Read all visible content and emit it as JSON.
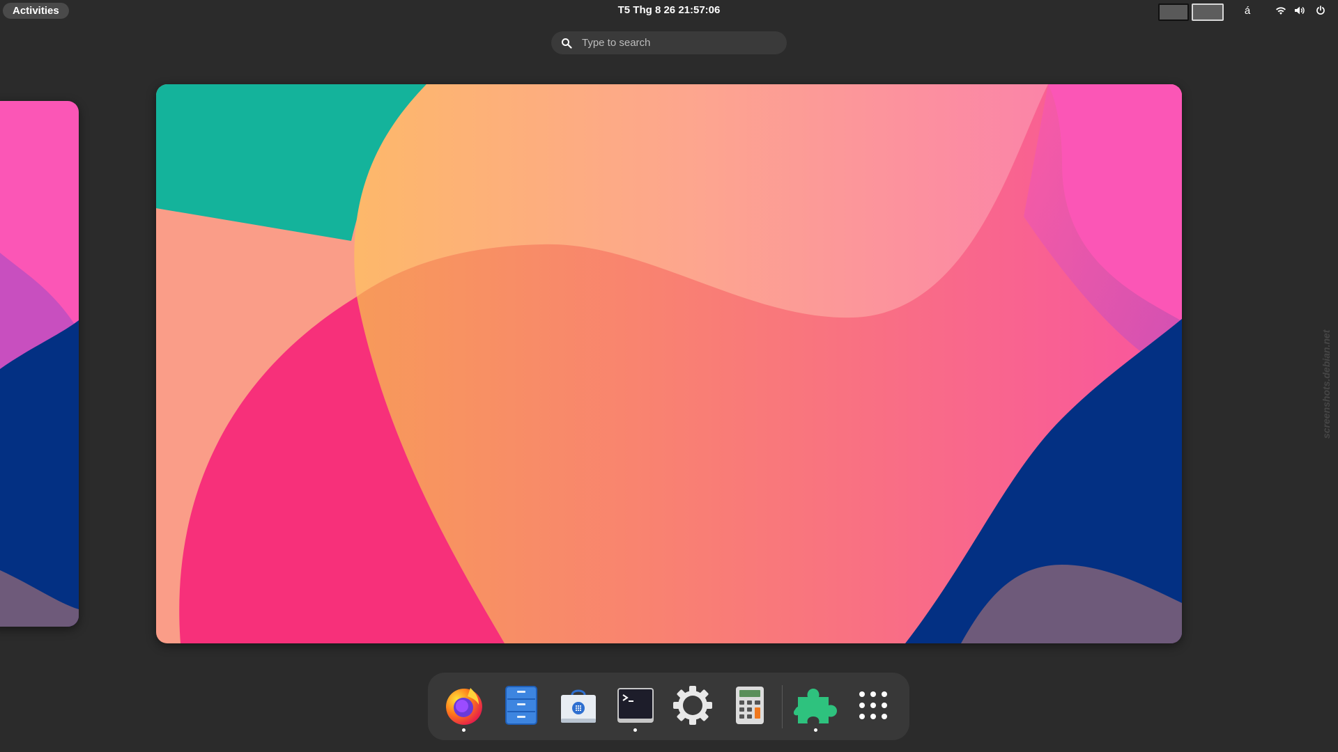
{
  "topbar": {
    "activities_label": "Activities",
    "clock": "T5 Thg 8 26  21:57:06",
    "keyboard_indicator": "á"
  },
  "search": {
    "placeholder": "Type to search"
  },
  "watermark": "screenshots.debian.net",
  "dash": {
    "apps": [
      {
        "name": "Firefox",
        "icon": "firefox-icon",
        "running": true
      },
      {
        "name": "Files",
        "icon": "files-icon",
        "running": false
      },
      {
        "name": "Software",
        "icon": "software-icon",
        "running": false
      },
      {
        "name": "Terminal",
        "icon": "terminal-icon",
        "running": true
      },
      {
        "name": "Settings",
        "icon": "settings-icon",
        "running": false
      },
      {
        "name": "Calculator",
        "icon": "calculator-icon",
        "running": false
      },
      {
        "name": "Extensions",
        "icon": "extensions-icon",
        "running": true
      },
      {
        "name": "Show Applications",
        "icon": "app-grid-icon",
        "running": false
      }
    ]
  },
  "colors": {
    "panel_bg": "#2b2b2b",
    "dash_bg": "#383838",
    "wallpaper_teal": "#14b39b",
    "wallpaper_pink": "#fb56b6",
    "wallpaper_navy": "#033083",
    "wallpaper_rose": "#f7307a"
  }
}
